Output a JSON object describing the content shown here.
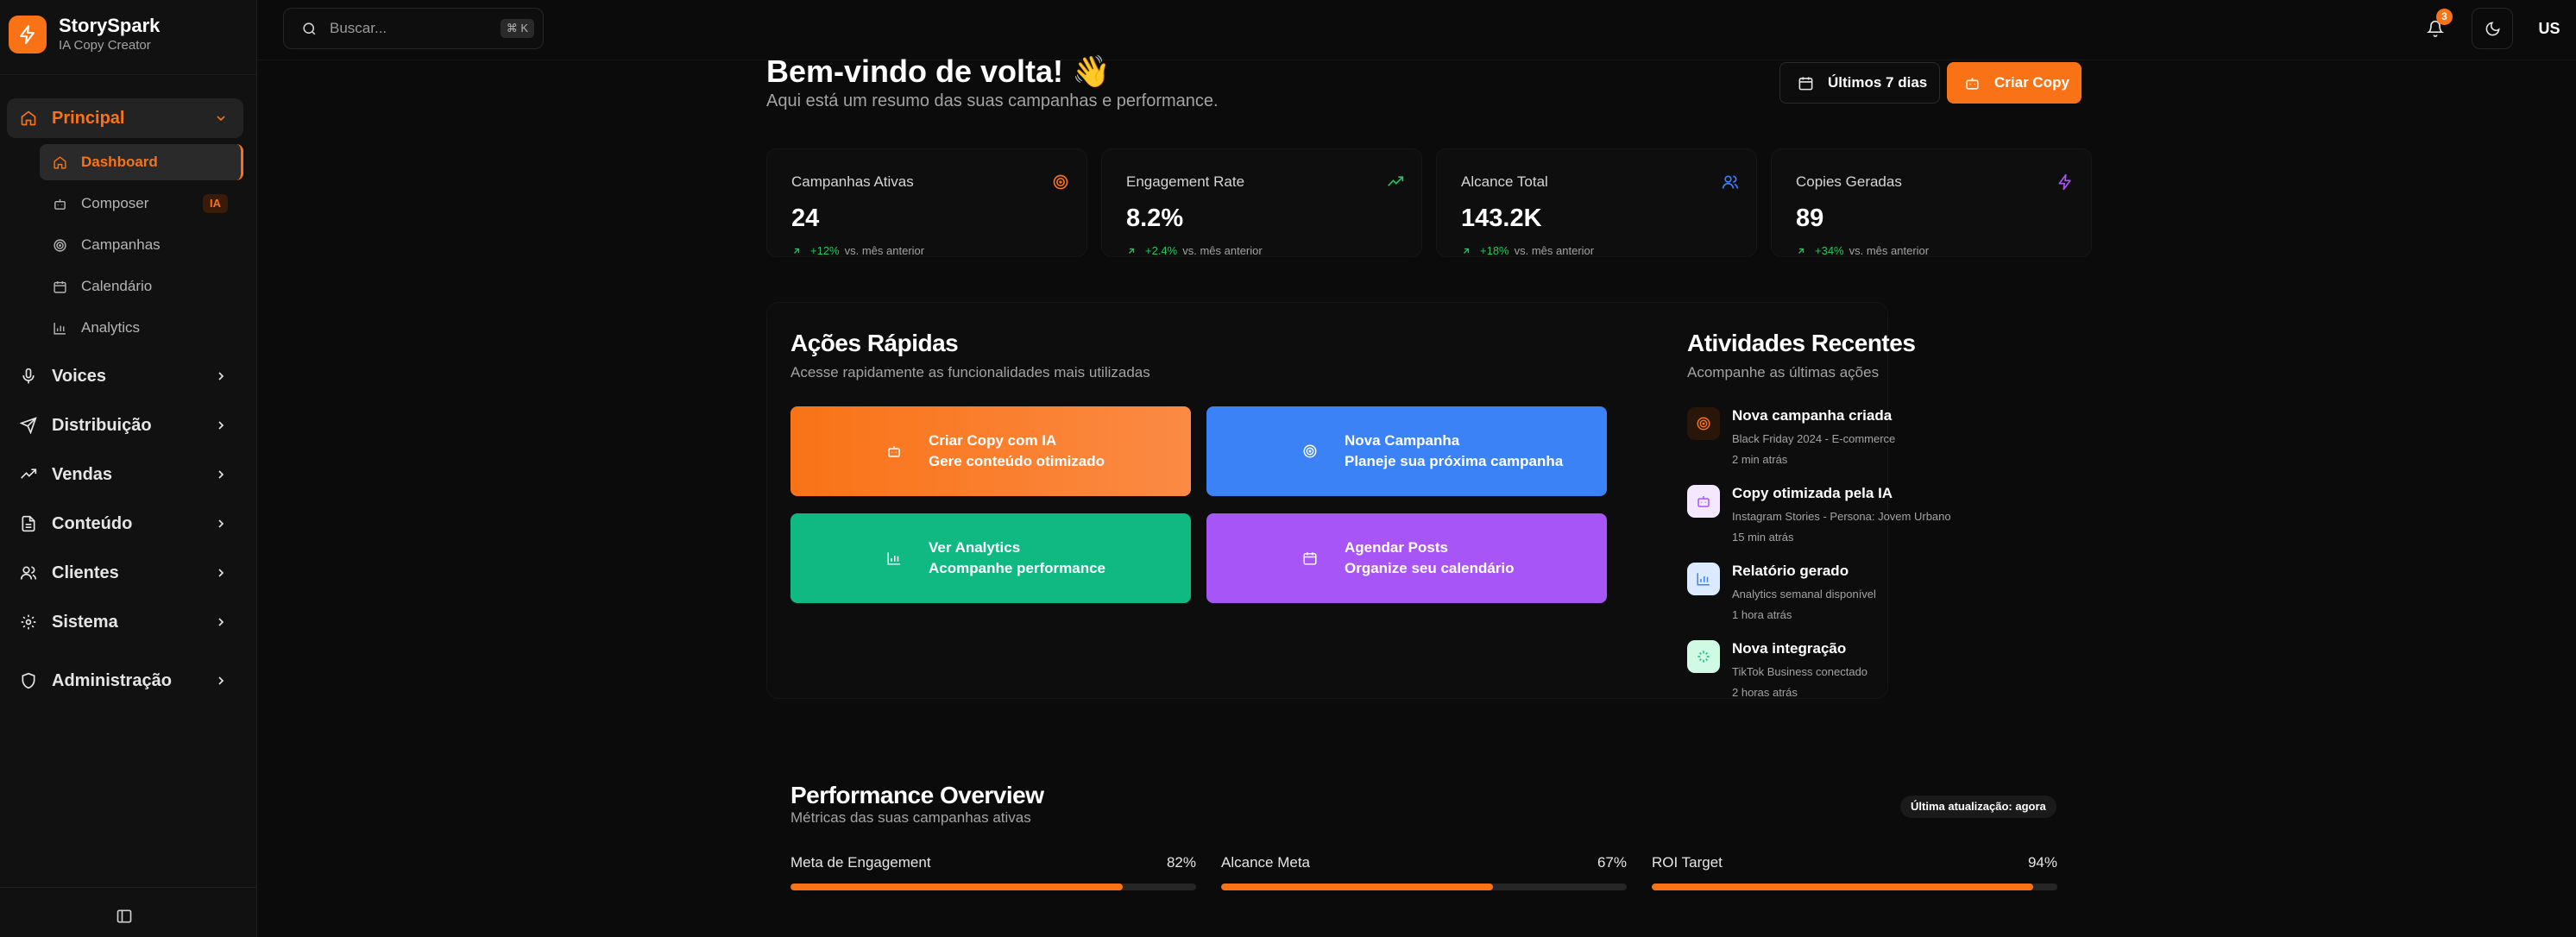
{
  "brand": {
    "name": "StorySpark",
    "subtitle": "IA Copy Creator"
  },
  "sidebar": {
    "sections": [
      {
        "label": "Principal",
        "icon": "home-icon"
      },
      {
        "label": "Voices",
        "icon": "mic-icon"
      },
      {
        "label": "Distribuição",
        "icon": "send-icon"
      },
      {
        "label": "Vendas",
        "icon": "trending-up-icon"
      },
      {
        "label": "Conteúdo",
        "icon": "file-icon"
      },
      {
        "label": "Clientes",
        "icon": "users-icon"
      },
      {
        "label": "Sistema",
        "icon": "gear-icon"
      },
      {
        "label": "Administração",
        "icon": "shield-icon"
      }
    ],
    "sub_items": [
      {
        "label": "Dashboard",
        "icon": "home-icon"
      },
      {
        "label": "Composer",
        "icon": "bot-icon",
        "badge": "IA"
      },
      {
        "label": "Campanhas",
        "icon": "target-icon"
      },
      {
        "label": "Calendário",
        "icon": "calendar-icon"
      },
      {
        "label": "Analytics",
        "icon": "bar-chart-icon"
      }
    ]
  },
  "topbar": {
    "search_placeholder": "Buscar...",
    "shortcut": "⌘ K",
    "notification_count": "3",
    "avatar_initials": "US"
  },
  "header": {
    "title": "Bem-vindo de volta! 👋",
    "subtitle": "Aqui está um resumo das suas campanhas e performance.",
    "range_button": "Últimos 7 dias",
    "create_button": "Criar Copy"
  },
  "stats": [
    {
      "title": "Campanhas Ativas",
      "value": "24",
      "delta": "+12%",
      "delta_suffix": "vs. mês anterior",
      "icon": "target-icon",
      "color": "#f97316"
    },
    {
      "title": "Engagement Rate",
      "value": "8.2%",
      "delta": "+2.4%",
      "delta_suffix": "vs. mês anterior",
      "icon": "trending-up-icon",
      "color": "#22c55e"
    },
    {
      "title": "Alcance Total",
      "value": "143.2K",
      "delta": "+18%",
      "delta_suffix": "vs. mês anterior",
      "icon": "users-icon",
      "color": "#3b82f6"
    },
    {
      "title": "Copies Geradas",
      "value": "89",
      "delta": "+34%",
      "delta_suffix": "vs. mês anterior",
      "icon": "zap-icon",
      "color": "#a855f7"
    }
  ],
  "quick_actions": {
    "title": "Ações Rápidas",
    "subtitle": "Acesse rapidamente as funcionalidades mais utilizadas",
    "items": [
      {
        "title": "Criar Copy com IA",
        "subtitle": "Gere conteúdo otimizado",
        "icon": "bot-icon",
        "color": "#f97316"
      },
      {
        "title": "Nova Campanha",
        "subtitle": "Planeje sua próxima campanha",
        "icon": "target-icon",
        "color": "#3b82f6"
      },
      {
        "title": "Ver Analytics",
        "subtitle": "Acompanhe performance",
        "icon": "bar-chart-icon",
        "color": "#10b981"
      },
      {
        "title": "Agendar Posts",
        "subtitle": "Organize seu calendário",
        "icon": "calendar-icon",
        "color": "#a855f7"
      }
    ]
  },
  "activities": {
    "title": "Atividades Recentes",
    "subtitle": "Acompanhe as últimas ações",
    "items": [
      {
        "title": "Nova campanha criada",
        "description": "Black Friday 2024 - E-commerce",
        "time": "2 min atrás",
        "icon": "target-icon",
        "color": "#f97316"
      },
      {
        "title": "Copy otimizada pela IA",
        "description": "Instagram Stories - Persona: Jovem Urbano",
        "time": "15 min atrás",
        "icon": "bot-icon",
        "color": "#a855f7"
      },
      {
        "title": "Relatório gerado",
        "description": "Analytics semanal disponível",
        "time": "1 hora atrás",
        "icon": "bar-chart-icon",
        "color": "#3b82f6"
      },
      {
        "title": "Nova integração",
        "description": "TikTok Business conectado",
        "time": "2 horas atrás",
        "icon": "sparkles-icon",
        "color": "#10b981"
      }
    ]
  },
  "performance": {
    "title": "Performance Overview",
    "subtitle": "Métricas das suas campanhas ativas",
    "updated": "Última atualização: agora",
    "metrics": [
      {
        "label": "Meta de Engagement",
        "percent_label": "82%",
        "value": 0.82
      },
      {
        "label": "Alcance Meta",
        "percent_label": "67%",
        "value": 0.67
      },
      {
        "label": "ROI Target",
        "percent_label": "94%",
        "value": 0.94
      }
    ]
  },
  "colors": {
    "accent": "#f97316",
    "positive": "#22c55e"
  }
}
